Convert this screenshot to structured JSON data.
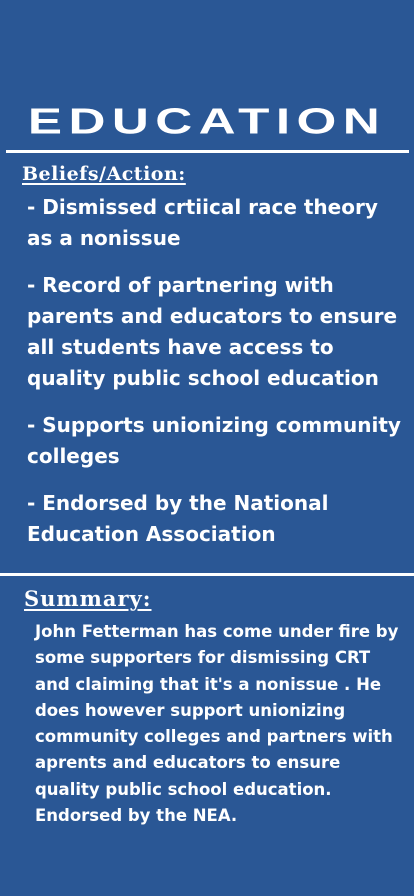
{
  "page": {
    "title": "EDUCATION",
    "beliefs_heading": "Beliefs/Action:",
    "items": [
      "- Dismissed crtiical race theory as a nonissue",
      "- Record of partnering with parents and educators to ensure all students have access to quality public school education",
      "- Supports unionizing community colleges",
      "- Endorsed by the National Education Association"
    ],
    "summary_heading": "Summary:",
    "summary_text": "John Fetterman has come under fire by some supporters for dismissing CRT and claiming that it's a nonissue . He does however support unionizing community colleges and partners with aprents and educators to ensure quality public school education. Endorsed by the NEA."
  },
  "colors": {
    "background": "#2a5795",
    "text": "#ffffff"
  }
}
